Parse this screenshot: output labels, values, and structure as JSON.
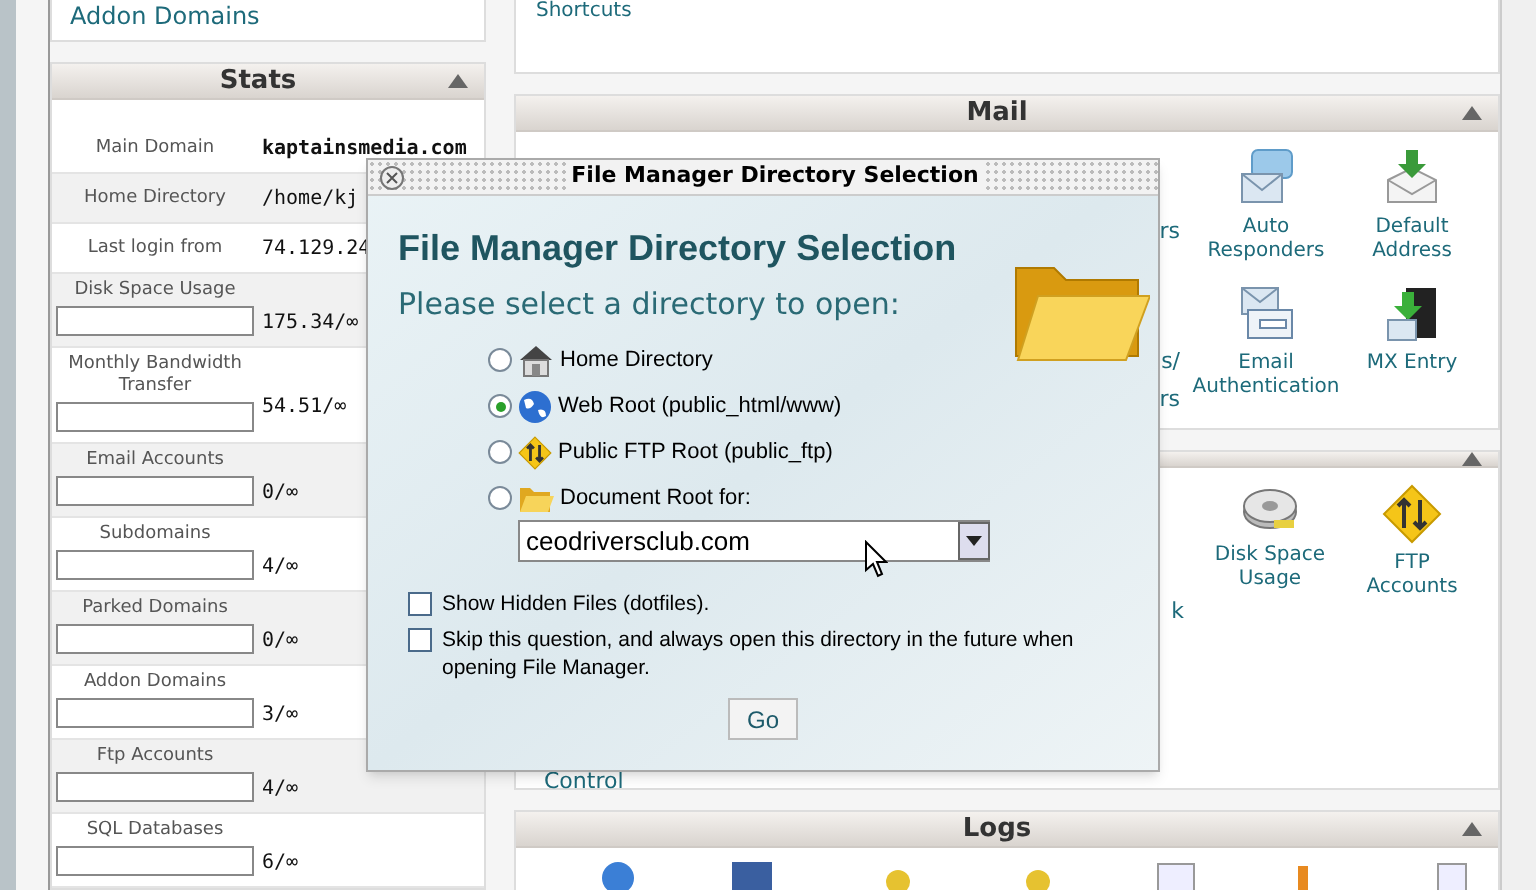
{
  "shortcuts_panel": {
    "link": "Shortcuts"
  },
  "sidebar_top": {
    "link": "Addon Domains"
  },
  "stats": {
    "title": "Stats",
    "expanded": true,
    "rows": [
      {
        "kind": "highlight",
        "label": "Main Domain",
        "value": "kaptainsmedia.com"
      },
      {
        "kind": "plain",
        "label": "Home Directory",
        "value": "/home/kj"
      },
      {
        "kind": "plain",
        "label": "Last login from",
        "value": "74.129.24"
      },
      {
        "kind": "bar",
        "label": "Disk Space Usage",
        "value": "175.34/∞"
      },
      {
        "kind": "bar",
        "label": "Monthly Bandwidth Transfer",
        "value": "54.51/∞"
      },
      {
        "kind": "bar",
        "label": "Email Accounts",
        "value": "0/∞"
      },
      {
        "kind": "bar",
        "label": "Subdomains",
        "value": "4/∞"
      },
      {
        "kind": "bar",
        "label": "Parked Domains",
        "value": "0/∞"
      },
      {
        "kind": "bar",
        "label": "Addon Domains",
        "value": "3/∞"
      },
      {
        "kind": "bar",
        "label": "Ftp Accounts",
        "value": "4/∞"
      },
      {
        "kind": "bar",
        "label": "SQL Databases",
        "value": "6/∞"
      }
    ]
  },
  "mail": {
    "title": "Mail",
    "expanded": true,
    "fragments": [
      "rs",
      "s/",
      "rs"
    ],
    "items": [
      {
        "kind": "autoresponder",
        "label": "Auto Responders"
      },
      {
        "kind": "default-address",
        "label": "Default Address"
      },
      {
        "kind": "authentication",
        "label": "Email Authentication"
      },
      {
        "kind": "mx",
        "label": "MX Entry"
      }
    ]
  },
  "files": {
    "expanded": true,
    "fragment": "k",
    "items": [
      {
        "kind": "disk",
        "label": "Disk Space Usage"
      },
      {
        "kind": "ftp",
        "label": "FTP Accounts"
      }
    ],
    "cut_link": "Control"
  },
  "logs": {
    "title": "Logs",
    "expanded": true
  },
  "dialog": {
    "window_title": "File Manager Directory Selection",
    "heading": "File Manager Directory Selection",
    "prompt": "Please select a directory to open:",
    "options": [
      {
        "kind": "home",
        "label": "Home Directory",
        "selected": false
      },
      {
        "kind": "web",
        "label": "Web Root (public_html/www)",
        "selected": true
      },
      {
        "kind": "ftp",
        "label": "Public FTP Root (public_ftp)",
        "selected": false
      },
      {
        "kind": "docroot",
        "label": "Document Root for:",
        "selected": false
      }
    ],
    "select": {
      "value": "ceodriversclub.com"
    },
    "checkboxes": [
      {
        "label": "Show Hidden Files (dotfiles).",
        "checked": false
      },
      {
        "label": "Skip this question, and always open this directory in the future when opening File Manager.",
        "checked": false
      }
    ],
    "button": "Go"
  }
}
